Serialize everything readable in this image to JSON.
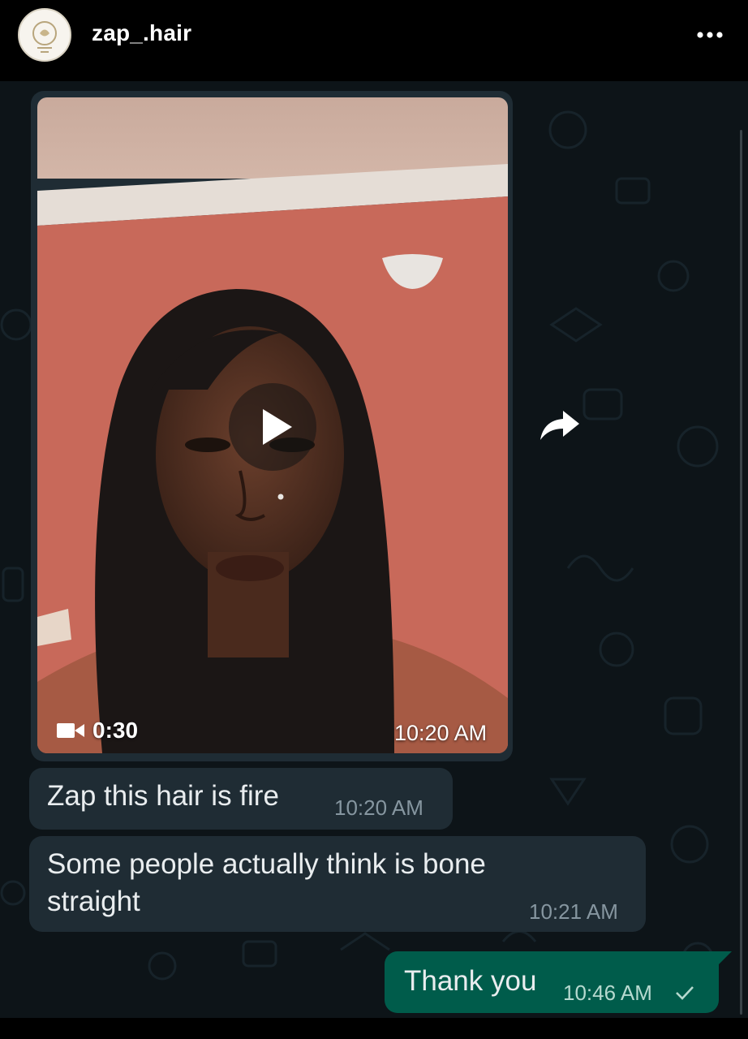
{
  "header": {
    "username": "zap_.hair",
    "avatar_icon": "brand-logo-avatar",
    "more_icon": "more-options-icon"
  },
  "chat": {
    "video_message": {
      "duration": "0:30",
      "time": "10:20 AM",
      "play_icon": "play-icon",
      "camera_icon": "video-camera-icon"
    },
    "forward_icon": "forward-icon",
    "messages": [
      {
        "direction": "incoming",
        "text": "Zap this hair is fire",
        "time": "10:20 AM"
      },
      {
        "direction": "incoming",
        "text": "Some people actually think is bone straight",
        "time": "10:21 AM"
      },
      {
        "direction": "outgoing",
        "text": "Thank you",
        "time": "10:46 AM",
        "status": "sent"
      }
    ]
  },
  "colors": {
    "chat_background": "#0d1418",
    "incoming_bubble": "#1f2c34",
    "outgoing_bubble": "#005c4b",
    "wall": "#c9695a"
  }
}
